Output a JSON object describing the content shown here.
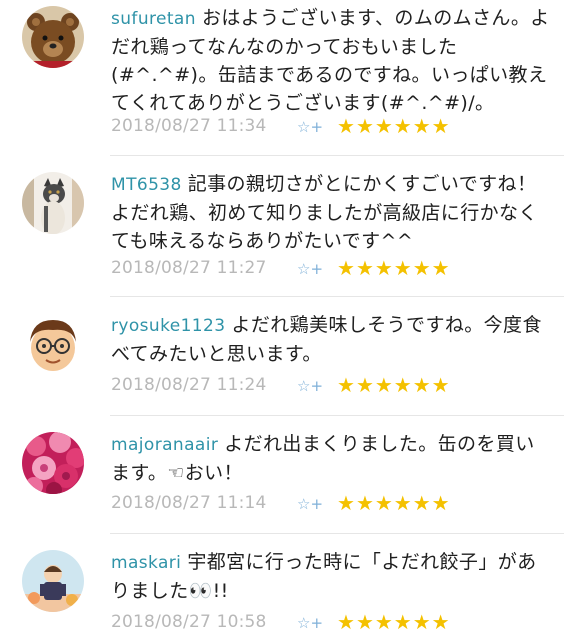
{
  "comments": [
    {
      "user": "sufuretan",
      "text": "おはようございます、のムのムさん。よだれ鶏ってなんなのかっておもいました(#^.^#)。缶詰まであるのですね。いっぱい教えてくれてありがとうございます(#^.^#)/。",
      "timestamp": "2018/08/27 11:34",
      "stars": "★★★★★★",
      "avatar_icon": "teddy-bear-avatar"
    },
    {
      "user": "MT6538",
      "text": "記事の親切さがとにかくすごいですね！よだれ鶏、初めて知りましたが高級店に行かなくても味えるならありがたいです^^",
      "timestamp": "2018/08/27 11:27",
      "stars": "★★★★★★",
      "avatar_icon": "cat-avatar"
    },
    {
      "user": "ryosuke1123",
      "text": "よだれ鶏美味しそうですね。今度食べてみたいと思います。",
      "timestamp": "2018/08/27 11:24",
      "stars": "★★★★★★",
      "avatar_icon": "cartoon-face-avatar"
    },
    {
      "user": "majoranaair",
      "text": "よだれ出まくりました。缶のを買います。☜おい！",
      "timestamp": "2018/08/27 11:14",
      "stars": "★★★★★★",
      "avatar_icon": "roses-avatar"
    },
    {
      "user": "maskari",
      "text": "宇都宮に行った時に「よだれ餃子」がありました👀!!",
      "timestamp": "2018/08/27 10:58",
      "stars": "★★★★★★",
      "avatar_icon": "illustration-avatar"
    }
  ],
  "favorite_icon": "star-plus-icon",
  "colors": {
    "username": "#2f93a8",
    "timestamp": "#b8b8b8",
    "star": "#f4c100",
    "favorite_icon": "#7fb0d8",
    "divider": "#e6e6e6"
  }
}
